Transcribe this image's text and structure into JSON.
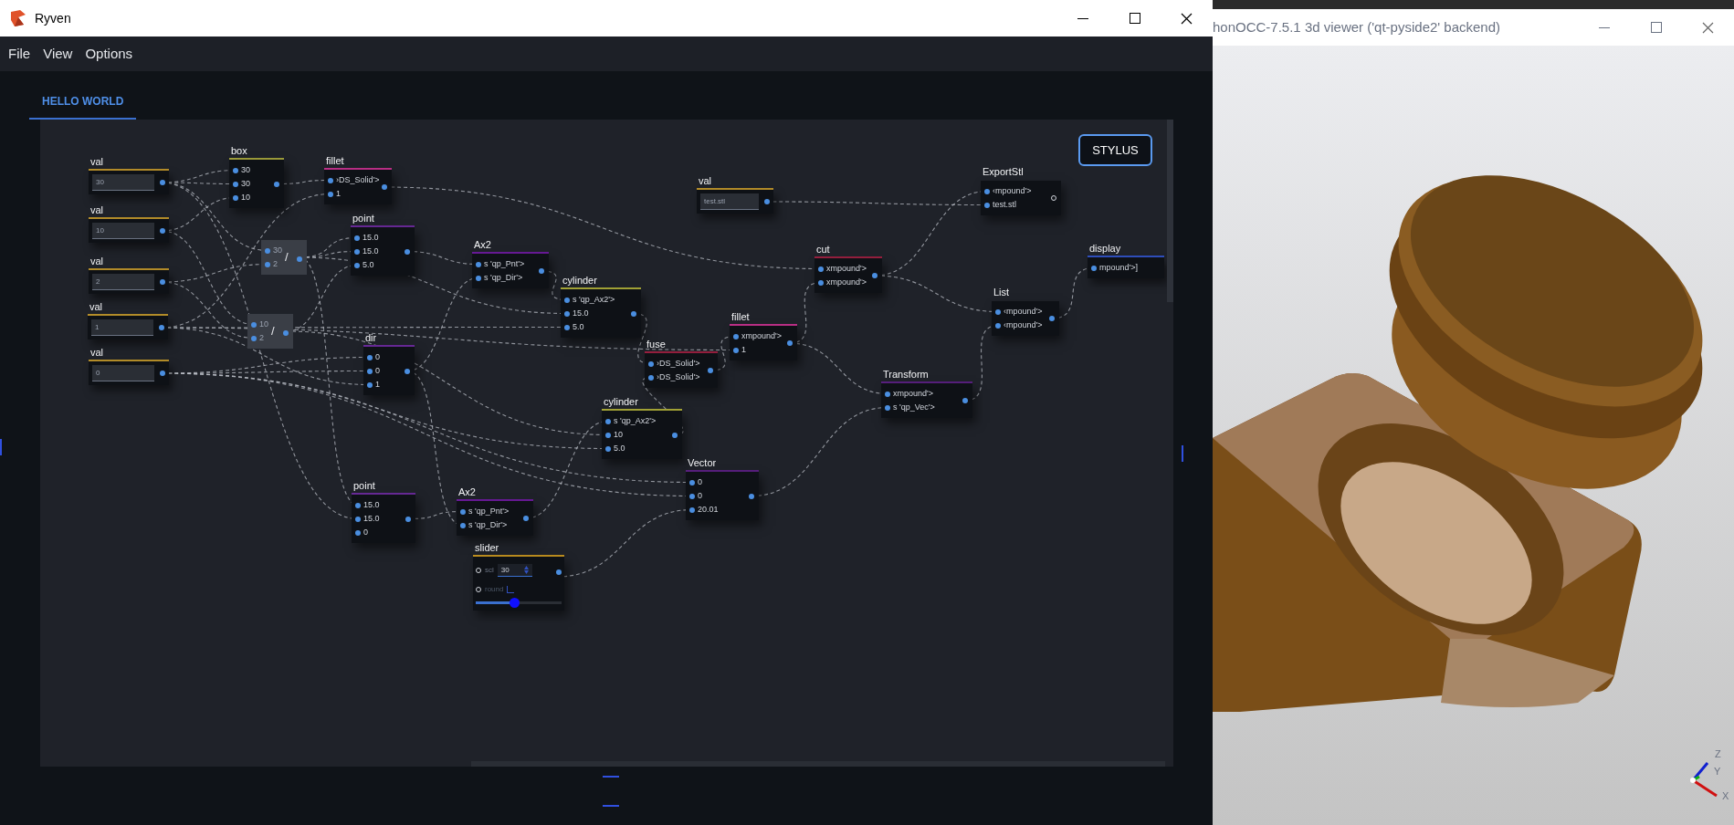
{
  "window": {
    "title": "Ryven",
    "menu": [
      "File",
      "View",
      "Options"
    ]
  },
  "tabs": [
    {
      "label": "HELLO WORLD",
      "selected": true
    }
  ],
  "canvas": {
    "stylus_button": "STYLUS",
    "nodes": [
      {
        "kind": "value",
        "title": "val",
        "color": "#b8902a",
        "value": "30"
      },
      {
        "kind": "value",
        "title": "val",
        "color": "#b8902a",
        "value": "10"
      },
      {
        "kind": "value",
        "title": "val",
        "color": "#b8902a",
        "value": "2"
      },
      {
        "kind": "value",
        "title": "val",
        "color": "#b8902a",
        "value": "1"
      },
      {
        "kind": "value",
        "title": "val",
        "color": "#b8902a",
        "value": "0"
      },
      {
        "kind": "ports",
        "title": "box",
        "color": "#a0a03c",
        "ports": [
          "30",
          "30",
          "10"
        ],
        "output_hollow": false
      },
      {
        "kind": "ports",
        "title": "fillet",
        "color": "#c0308a",
        "ports": [
          "›DS_Solid'>",
          "1"
        ],
        "output_hollow": false
      },
      {
        "kind": "operator",
        "symbol": "/",
        "ports": [
          "30",
          "2"
        ]
      },
      {
        "kind": "ports",
        "title": "point",
        "color": "#6a2a9a",
        "ports": [
          "15.0",
          "15.0",
          "5.0"
        ],
        "output_hollow": false
      },
      {
        "kind": "operator",
        "symbol": "/",
        "ports": [
          "10",
          "2"
        ]
      },
      {
        "kind": "ports",
        "title": "dir",
        "color": "#6a2a9a",
        "ports": [
          "0",
          "0",
          "1"
        ],
        "output_hollow": false
      },
      {
        "kind": "ports",
        "title": "Ax2",
        "color": "#6a1a9a",
        "ports": [
          "s 'qp_Pnt'>",
          "s 'qp_Dir'>"
        ],
        "output_hollow": false
      },
      {
        "kind": "ports",
        "title": "cylinder",
        "color": "#a8a838",
        "ports": [
          "s 'qp_Ax2'>",
          "15.0",
          "5.0"
        ],
        "output_hollow": false
      },
      {
        "kind": "value",
        "title": "val",
        "color": "#b8902a",
        "value": "test.stl"
      },
      {
        "kind": "ports",
        "title": "fuse",
        "color": "#9a2040",
        "ports": [
          "›DS_Solid'>",
          "›DS_Solid'>"
        ],
        "output_hollow": false
      },
      {
        "kind": "ports",
        "title": "fillet",
        "color": "#c0308a",
        "ports": [
          "xmpound'>",
          "1"
        ],
        "output_hollow": false
      },
      {
        "kind": "ports",
        "title": "cut",
        "color": "#9a2040",
        "ports": [
          "xmpound'>",
          "xmpound'>"
        ],
        "output_hollow": false
      },
      {
        "kind": "ports",
        "title": "ExportStl",
        "ports": [
          "‹mpound'>",
          "test.stl"
        ],
        "output_hollow": true
      },
      {
        "kind": "sink",
        "title": "display",
        "color": "#3050c0",
        "ports": [
          "mpound'>]"
        ]
      },
      {
        "kind": "ports",
        "title": "List",
        "ports": [
          "‹mpound'>",
          "‹mpound'>"
        ],
        "output_hollow": false
      },
      {
        "kind": "ports",
        "title": "Transform",
        "color": "#5a2080",
        "ports": [
          "xmpound'>",
          "s 'qp_Vec'>"
        ],
        "output_hollow": false
      },
      {
        "kind": "ports",
        "title": "cylinder",
        "color": "#a8a838",
        "ports": [
          "s 'qp_Ax2'>",
          "10",
          "5.0"
        ],
        "output_hollow": false
      },
      {
        "kind": "ports",
        "title": "Vector",
        "color": "#5a2080",
        "ports": [
          "0",
          "0",
          "20.01"
        ],
        "output_hollow": false
      },
      {
        "kind": "ports",
        "title": "point",
        "color": "#6a2a9a",
        "ports": [
          "15.0",
          "15.0",
          "0"
        ],
        "output_hollow": false
      },
      {
        "kind": "ports",
        "title": "Ax2",
        "color": "#6a1a9a",
        "ports": [
          "s 'qp_Pnt'>",
          "s 'qp_Dir'>"
        ],
        "output_hollow": false
      },
      {
        "kind": "slider",
        "title": "slider",
        "color": "#c09020",
        "scale_label": "scl",
        "scale_value": "30",
        "round_label": "round",
        "round_checked": false,
        "level": 0.45
      }
    ]
  },
  "viewer": {
    "title": "honOCC-7.5.1 3d viewer ('qt-pyside2' backend)",
    "axis_labels": [
      "Z",
      "Y",
      "X"
    ]
  }
}
